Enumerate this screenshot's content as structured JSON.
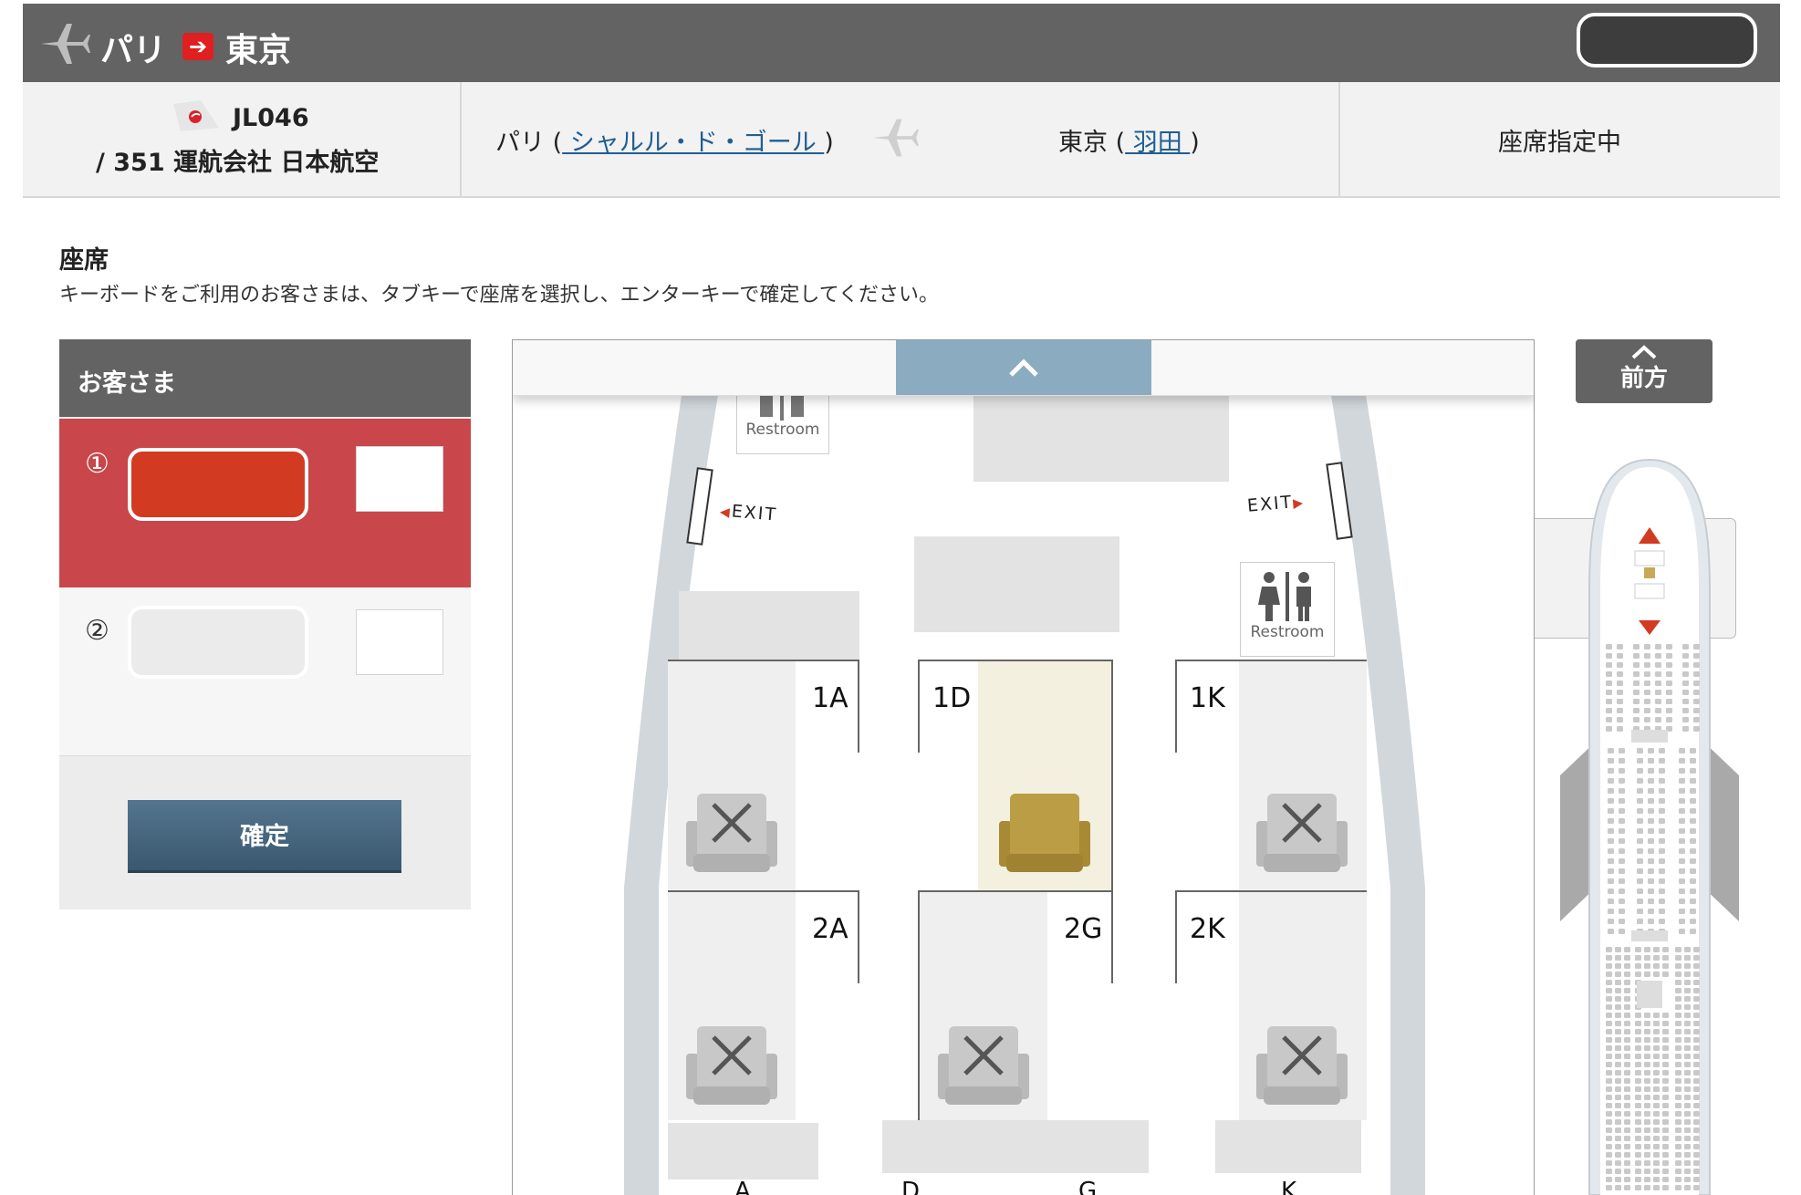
{
  "header": {
    "origin": "パリ",
    "arrow": "➔",
    "destination": "東京"
  },
  "flight": {
    "number": "JL046",
    "detail": "/ 351 運航会社 日本航空",
    "from_city": "パリ (",
    "from_airport": " シャルル・ド・ゴール ",
    "from_close": ")",
    "to_city": "東京 (",
    "to_airport": " 羽田 ",
    "to_close": ")",
    "status": "座席指定中"
  },
  "section": {
    "title": "座席",
    "description": "キーボードをご利用のお客さまは、タブキーで座席を選択し、エンターキーで確定してください。"
  },
  "passengers": {
    "header": "お客さま",
    "items": [
      {
        "number": "①"
      },
      {
        "number": "②"
      }
    ],
    "confirm_label": "確定"
  },
  "seatmap": {
    "up_arrow": "⌃",
    "restroom_label": "Restroom",
    "exit_label": "EXIT",
    "seats": [
      {
        "id": "1A",
        "status": "unavailable"
      },
      {
        "id": "1D",
        "status": "selected"
      },
      {
        "id": "1K",
        "status": "unavailable"
      },
      {
        "id": "2A",
        "status": "unavailable"
      },
      {
        "id": "2G",
        "status": "unavailable"
      },
      {
        "id": "2K",
        "status": "unavailable"
      }
    ],
    "columns_partial": [
      "A",
      "D",
      "G",
      "K"
    ]
  },
  "overview": {
    "forward_label": "前方",
    "up_arrow": "⌃"
  },
  "colors": {
    "header_bg": "#636363",
    "active_passenger_bg": "#c9464a",
    "name_field_active": "#d33a22",
    "confirm_button": "#3f5e76",
    "selected_seat": "#b99c42",
    "selected_seat_bg": "#f3f0e0",
    "unavailable_seat": "#c4c4c4",
    "link": "#1f5e93"
  }
}
